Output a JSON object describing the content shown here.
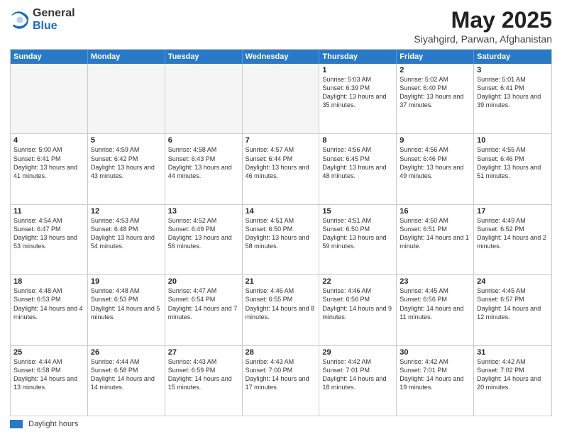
{
  "logo": {
    "general": "General",
    "blue": "Blue"
  },
  "title": {
    "month": "May 2025",
    "location": "Siyahgird, Parwan, Afghanistan"
  },
  "header_days": [
    "Sunday",
    "Monday",
    "Tuesday",
    "Wednesday",
    "Thursday",
    "Friday",
    "Saturday"
  ],
  "weeks": [
    [
      {
        "day": "",
        "info": "",
        "empty": true
      },
      {
        "day": "",
        "info": "",
        "empty": true
      },
      {
        "day": "",
        "info": "",
        "empty": true
      },
      {
        "day": "",
        "info": "",
        "empty": true
      },
      {
        "day": "1",
        "info": "Sunrise: 5:03 AM\nSunset: 6:39 PM\nDaylight: 13 hours\nand 35 minutes.",
        "empty": false
      },
      {
        "day": "2",
        "info": "Sunrise: 5:02 AM\nSunset: 6:40 PM\nDaylight: 13 hours\nand 37 minutes.",
        "empty": false
      },
      {
        "day": "3",
        "info": "Sunrise: 5:01 AM\nSunset: 6:41 PM\nDaylight: 13 hours\nand 39 minutes.",
        "empty": false
      }
    ],
    [
      {
        "day": "4",
        "info": "Sunrise: 5:00 AM\nSunset: 6:41 PM\nDaylight: 13 hours\nand 41 minutes.",
        "empty": false
      },
      {
        "day": "5",
        "info": "Sunrise: 4:59 AM\nSunset: 6:42 PM\nDaylight: 13 hours\nand 43 minutes.",
        "empty": false
      },
      {
        "day": "6",
        "info": "Sunrise: 4:58 AM\nSunset: 6:43 PM\nDaylight: 13 hours\nand 44 minutes.",
        "empty": false
      },
      {
        "day": "7",
        "info": "Sunrise: 4:57 AM\nSunset: 6:44 PM\nDaylight: 13 hours\nand 46 minutes.",
        "empty": false
      },
      {
        "day": "8",
        "info": "Sunrise: 4:56 AM\nSunset: 6:45 PM\nDaylight: 13 hours\nand 48 minutes.",
        "empty": false
      },
      {
        "day": "9",
        "info": "Sunrise: 4:56 AM\nSunset: 6:46 PM\nDaylight: 13 hours\nand 49 minutes.",
        "empty": false
      },
      {
        "day": "10",
        "info": "Sunrise: 4:55 AM\nSunset: 6:46 PM\nDaylight: 13 hours\nand 51 minutes.",
        "empty": false
      }
    ],
    [
      {
        "day": "11",
        "info": "Sunrise: 4:54 AM\nSunset: 6:47 PM\nDaylight: 13 hours\nand 53 minutes.",
        "empty": false
      },
      {
        "day": "12",
        "info": "Sunrise: 4:53 AM\nSunset: 6:48 PM\nDaylight: 13 hours\nand 54 minutes.",
        "empty": false
      },
      {
        "day": "13",
        "info": "Sunrise: 4:52 AM\nSunset: 6:49 PM\nDaylight: 13 hours\nand 56 minutes.",
        "empty": false
      },
      {
        "day": "14",
        "info": "Sunrise: 4:51 AM\nSunset: 6:50 PM\nDaylight: 13 hours\nand 58 minutes.",
        "empty": false
      },
      {
        "day": "15",
        "info": "Sunrise: 4:51 AM\nSunset: 6:50 PM\nDaylight: 13 hours\nand 59 minutes.",
        "empty": false
      },
      {
        "day": "16",
        "info": "Sunrise: 4:50 AM\nSunset: 6:51 PM\nDaylight: 14 hours\nand 1 minute.",
        "empty": false
      },
      {
        "day": "17",
        "info": "Sunrise: 4:49 AM\nSunset: 6:52 PM\nDaylight: 14 hours\nand 2 minutes.",
        "empty": false
      }
    ],
    [
      {
        "day": "18",
        "info": "Sunrise: 4:48 AM\nSunset: 6:53 PM\nDaylight: 14 hours\nand 4 minutes.",
        "empty": false
      },
      {
        "day": "19",
        "info": "Sunrise: 4:48 AM\nSunset: 6:53 PM\nDaylight: 14 hours\nand 5 minutes.",
        "empty": false
      },
      {
        "day": "20",
        "info": "Sunrise: 4:47 AM\nSunset: 6:54 PM\nDaylight: 14 hours\nand 7 minutes.",
        "empty": false
      },
      {
        "day": "21",
        "info": "Sunrise: 4:46 AM\nSunset: 6:55 PM\nDaylight: 14 hours\nand 8 minutes.",
        "empty": false
      },
      {
        "day": "22",
        "info": "Sunrise: 4:46 AM\nSunset: 6:56 PM\nDaylight: 14 hours\nand 9 minutes.",
        "empty": false
      },
      {
        "day": "23",
        "info": "Sunrise: 4:45 AM\nSunset: 6:56 PM\nDaylight: 14 hours\nand 11 minutes.",
        "empty": false
      },
      {
        "day": "24",
        "info": "Sunrise: 4:45 AM\nSunset: 6:57 PM\nDaylight: 14 hours\nand 12 minutes.",
        "empty": false
      }
    ],
    [
      {
        "day": "25",
        "info": "Sunrise: 4:44 AM\nSunset: 6:58 PM\nDaylight: 14 hours\nand 13 minutes.",
        "empty": false
      },
      {
        "day": "26",
        "info": "Sunrise: 4:44 AM\nSunset: 6:58 PM\nDaylight: 14 hours\nand 14 minutes.",
        "empty": false
      },
      {
        "day": "27",
        "info": "Sunrise: 4:43 AM\nSunset: 6:59 PM\nDaylight: 14 hours\nand 15 minutes.",
        "empty": false
      },
      {
        "day": "28",
        "info": "Sunrise: 4:43 AM\nSunset: 7:00 PM\nDaylight: 14 hours\nand 17 minutes.",
        "empty": false
      },
      {
        "day": "29",
        "info": "Sunrise: 4:42 AM\nSunset: 7:01 PM\nDaylight: 14 hours\nand 18 minutes.",
        "empty": false
      },
      {
        "day": "30",
        "info": "Sunrise: 4:42 AM\nSunset: 7:01 PM\nDaylight: 14 hours\nand 19 minutes.",
        "empty": false
      },
      {
        "day": "31",
        "info": "Sunrise: 4:42 AM\nSunset: 7:02 PM\nDaylight: 14 hours\nand 20 minutes.",
        "empty": false
      }
    ]
  ],
  "footer": {
    "label": "Daylight hours"
  }
}
